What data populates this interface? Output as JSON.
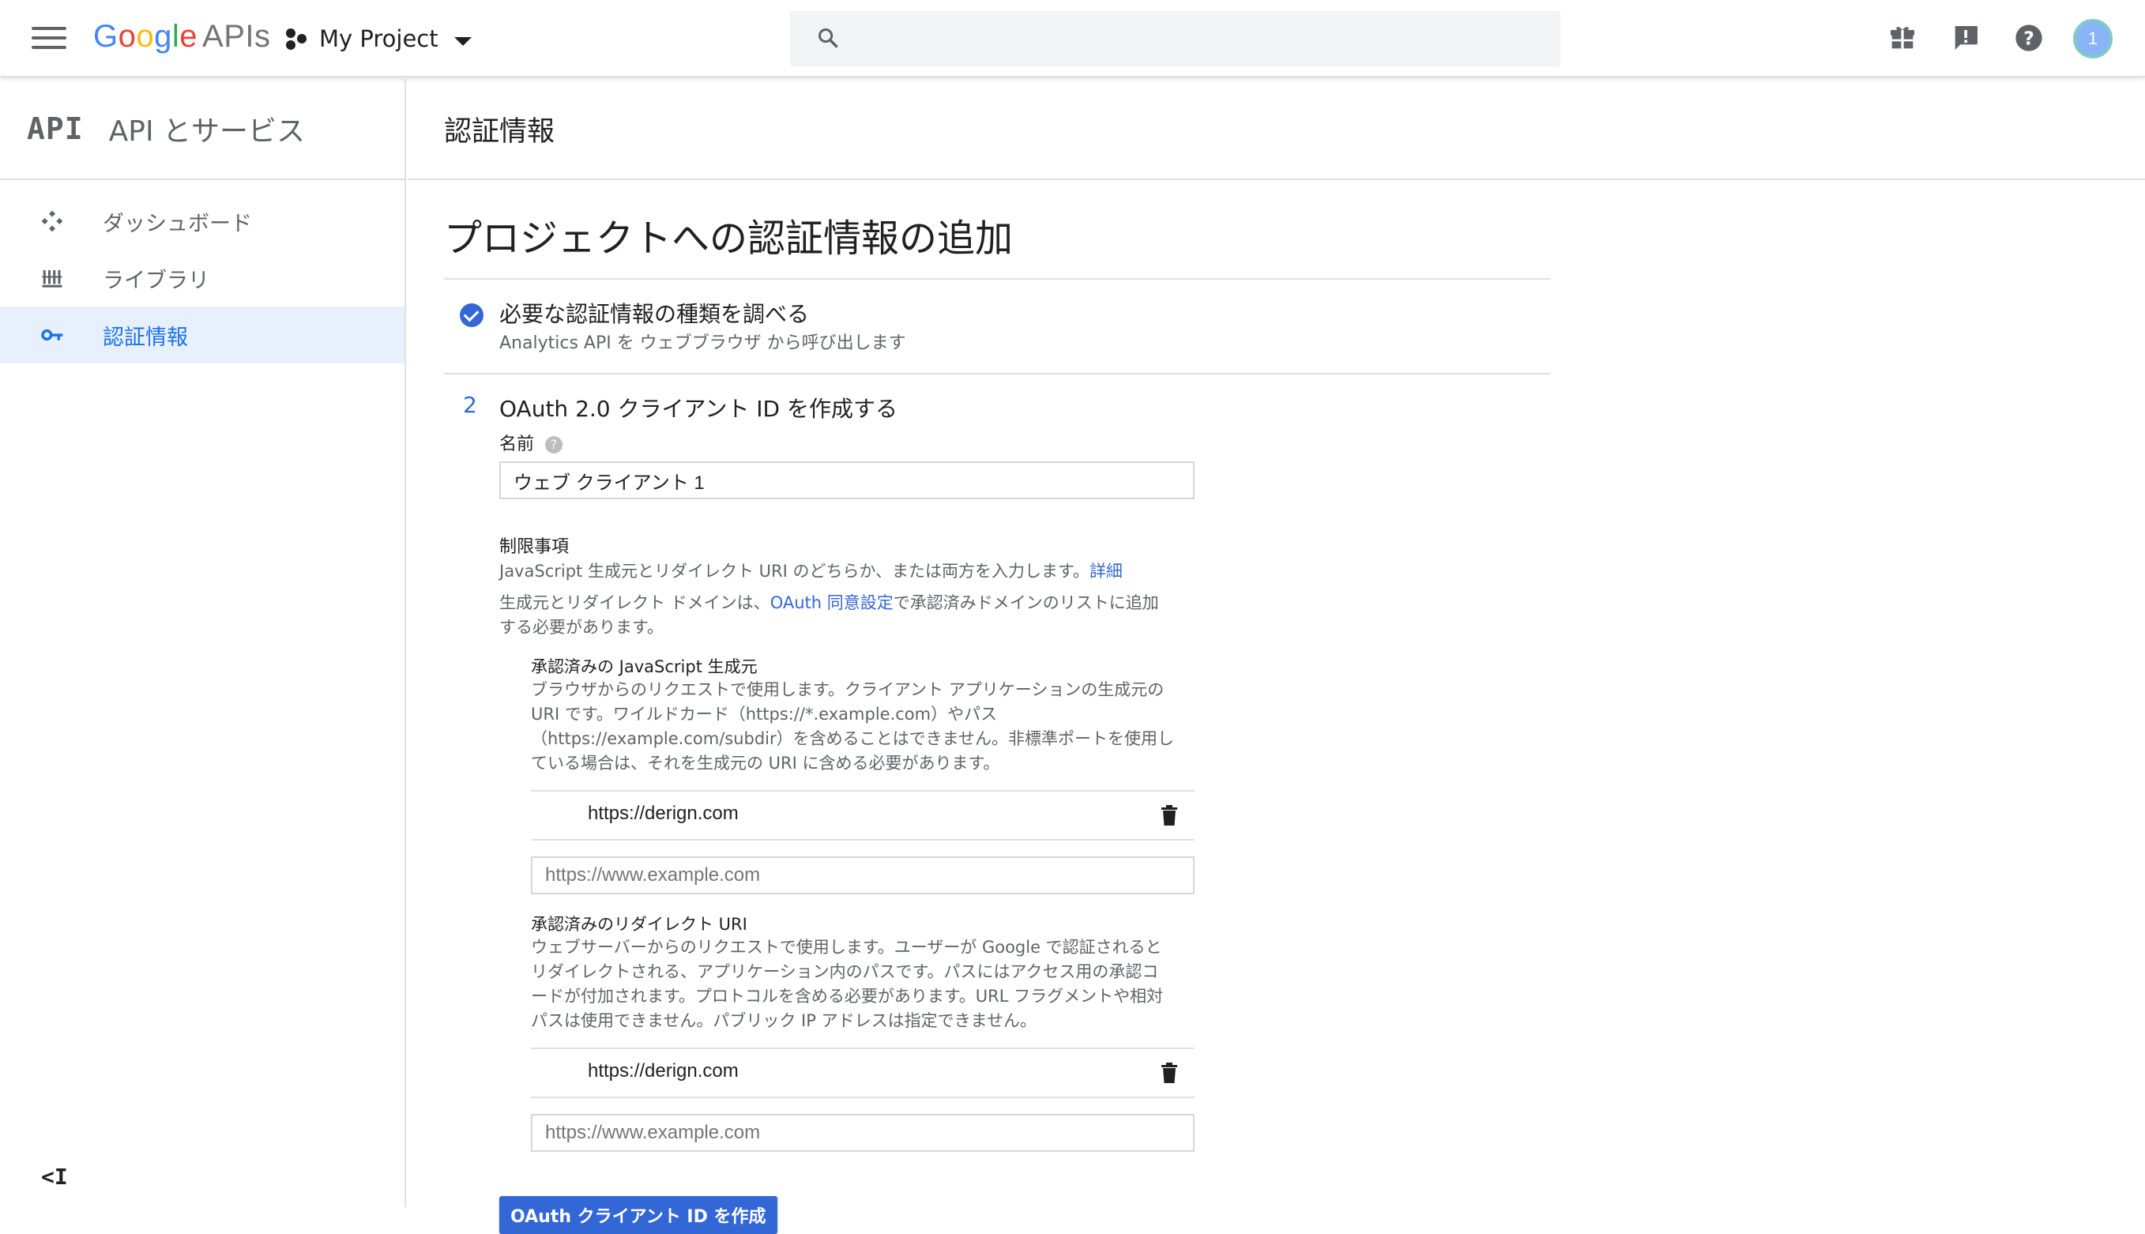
{
  "topbar": {
    "logo_google": "Google",
    "logo_apis": "APIs",
    "project_name": "My Project",
    "search_placeholder": "",
    "avatar_text": "1"
  },
  "sidebar": {
    "logo": "API",
    "title": "API とサービス",
    "items": [
      {
        "label": "ダッシュボード",
        "icon": "dashboard-icon"
      },
      {
        "label": "ライブラリ",
        "icon": "library-icon"
      },
      {
        "label": "認証情報",
        "icon": "key-icon",
        "active": true
      }
    ],
    "collapse_label": "<I"
  },
  "main": {
    "header_title": "認証情報",
    "page_title": "プロジェクトへの認証情報の追加",
    "step1": {
      "title": "必要な認証情報の種類を調べる",
      "subtitle": "Analytics API を ウェブブラウザ から呼び出します"
    },
    "step2": {
      "number": "2",
      "title": "OAuth 2.0 クライアント ID を作成する",
      "name_label": "名前",
      "help_glyph": "?",
      "name_value": "ウェブ クライアント 1",
      "restrictions_label": "制限事項",
      "restrictions_text": "JavaScript 生成元とリダイレクト URI のどちらか、または両方を入力します。",
      "restrictions_link": "詳細",
      "domain_text_pre": "生成元とリダイレクト ドメインは、",
      "domain_link": "OAuth 同意設定",
      "domain_text_post1": "で承認済みドメインのリストに追加",
      "domain_text_post2": "する必要があります。",
      "js_origins": {
        "label": "承認済みの JavaScript 生成元",
        "desc": [
          "ブラウザからのリクエストで使用します。クライアント アプリケーションの生成元の",
          "URI です。ワイルドカード（https://*.example.com）やパス",
          "（https://example.com/subdir）を含めることはできません。非標準ポートを使用し",
          "ている場合は、それを生成元の URI に含める必要があります。"
        ],
        "entry": "https://derign.com",
        "placeholder": "https://www.example.com"
      },
      "redirect_uris": {
        "label": "承認済みのリダイレクト URI",
        "desc": [
          "ウェブサーバーからのリクエストで使用します。ユーザーが Google で認証されると",
          "リダイレクトされる、アプリケーション内のパスです。パスにはアクセス用の承認コ",
          "ードが付加されます。プロトコルを含める必要があります。URL フラグメントや相対",
          "パスは使用できません。パブリック IP アドレスは指定できません。"
        ],
        "entry": "https://derign.com",
        "placeholder": "https://www.example.com"
      },
      "create_button": "OAuth クライアント ID を作成"
    }
  },
  "colors": {
    "accent": "#3367d6",
    "active_bg": "#e8f0fe",
    "divider": "#e0e0e0"
  }
}
